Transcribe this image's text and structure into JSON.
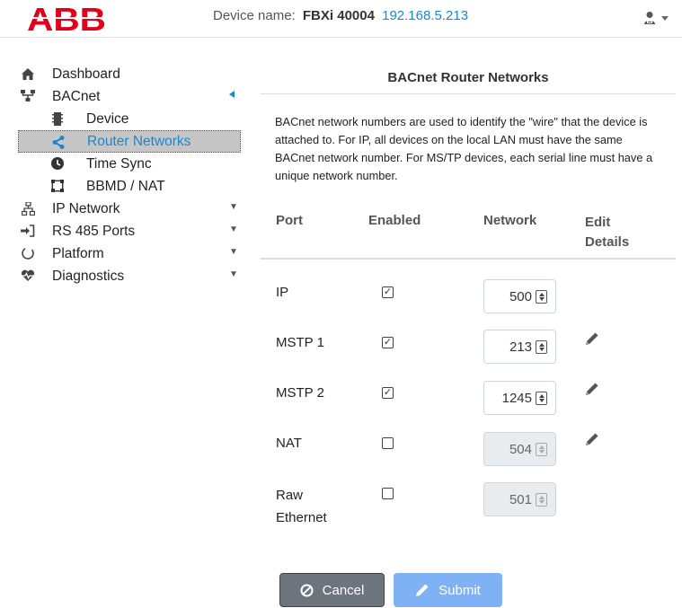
{
  "header": {
    "logo_text": "ABB",
    "device_label": "Device name:",
    "device_name": "FBXi 40004",
    "device_ip": "192.168.5.213",
    "user_icon": "user-icon"
  },
  "sidebar": {
    "items": [
      {
        "label": "Dashboard",
        "icon": "home-icon"
      },
      {
        "label": "BACnet",
        "icon": "network-tree-icon"
      },
      {
        "label": "Device",
        "icon": "device-icon"
      },
      {
        "label": "Router Networks",
        "icon": "share-icon"
      },
      {
        "label": "Time Sync",
        "icon": "clock-icon"
      },
      {
        "label": "BBMD / NAT",
        "icon": "bbmd-icon"
      },
      {
        "label": "IP Network",
        "icon": "sitemap-icon"
      },
      {
        "label": "RS 485 Ports",
        "icon": "sign-in-icon"
      },
      {
        "label": "Platform",
        "icon": "spinner-icon"
      },
      {
        "label": "Diagnostics",
        "icon": "heartbeat-icon"
      }
    ]
  },
  "main": {
    "title": "BACnet Router Networks",
    "description": "BACnet network numbers are used to identify the \"wire\" that the device is attached to. For IP, all devices on the local LAN must have the same BACnet network number. For MS/TP devices, each serial line must have a unique network number.",
    "columns": {
      "port": "Port",
      "enabled": "Enabled",
      "network": "Network",
      "edit_line1": "Edit",
      "edit_line2": "Details"
    },
    "rows": [
      {
        "port": "IP",
        "enabled": true,
        "network": "500",
        "editable": false,
        "disabled": false
      },
      {
        "port": "MSTP 1",
        "enabled": true,
        "network": "213",
        "editable": true,
        "disabled": false
      },
      {
        "port": "MSTP 2",
        "enabled": true,
        "network": "1245",
        "editable": true,
        "disabled": false
      },
      {
        "port": "NAT",
        "enabled": false,
        "network": "504",
        "editable": true,
        "disabled": true
      },
      {
        "port_line1": "Raw",
        "port_line2": "Ethernet",
        "enabled": false,
        "network": "501",
        "editable": false,
        "disabled": true
      }
    ]
  },
  "buttons": {
    "cancel": "Cancel",
    "submit": "Submit"
  },
  "colors": {
    "accent": "#1a86d0",
    "logo_red": "#e2001a",
    "cancel_bg": "#6c757d",
    "submit_bg": "#7fb2f5"
  }
}
